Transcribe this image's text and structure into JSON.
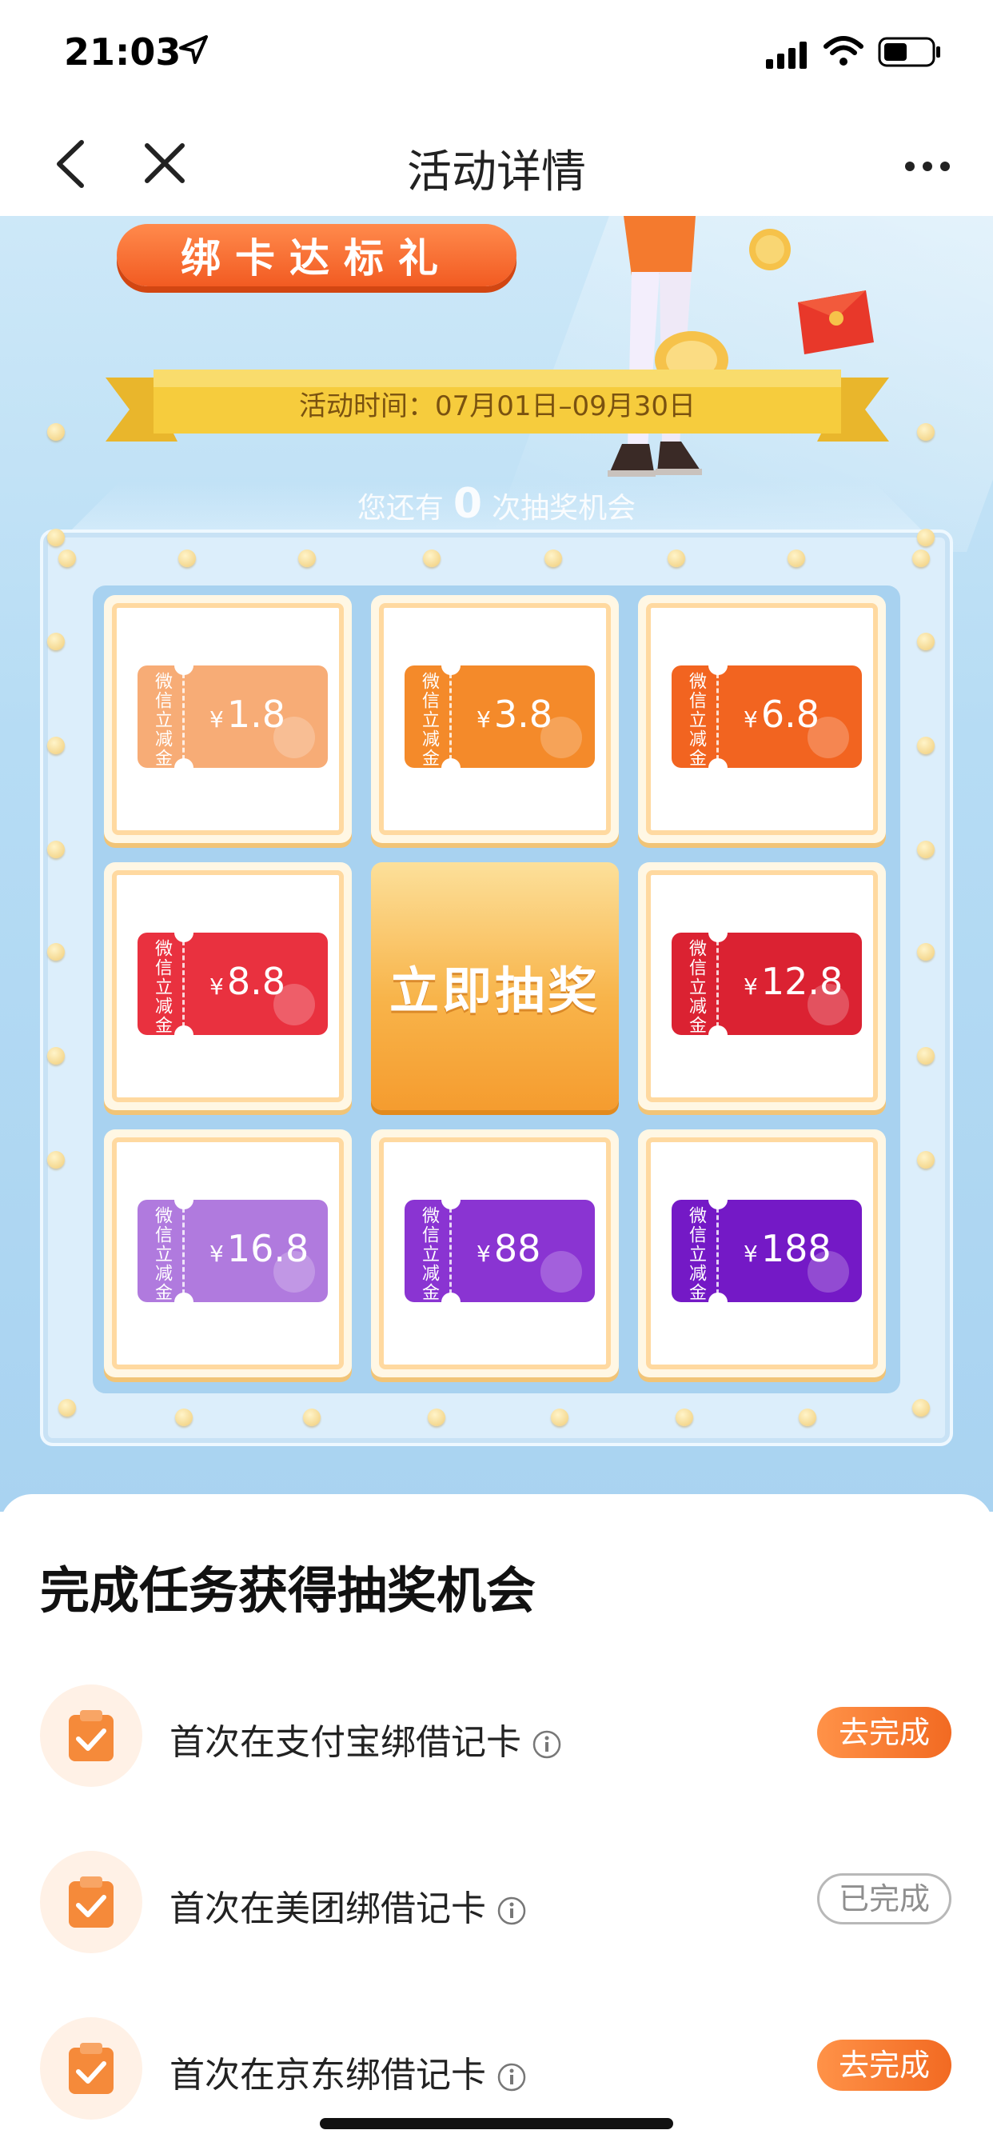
{
  "status_bar": {
    "time": "21:03"
  },
  "nav": {
    "title": "活动详情"
  },
  "hero": {
    "banner_title": "绑卡达标礼",
    "activity_time": "活动时间：07月01日–09月30日",
    "chances_prefix": "您还有",
    "chances_count": "0",
    "chances_suffix": "次抽奖机会"
  },
  "lottery": {
    "draw_button": "立即抽奖",
    "prizes": [
      {
        "label": "微信立减金",
        "currency": "¥",
        "amount": "1.8",
        "color": "#f7ac76"
      },
      {
        "label": "微信立减金",
        "currency": "¥",
        "amount": "3.8",
        "color": "#f48a2a"
      },
      {
        "label": "微信立减金",
        "currency": "¥",
        "amount": "6.8",
        "color": "#f26420"
      },
      {
        "label": "微信立减金",
        "currency": "¥",
        "amount": "8.8",
        "color": "#e9313f"
      },
      {
        "label": "微信立减金",
        "currency": "¥",
        "amount": "12.8",
        "color": "#db2232"
      },
      {
        "label": "微信立减金",
        "currency": "¥",
        "amount": "16.8",
        "color": "#b07ade"
      },
      {
        "label": "微信立减金",
        "currency": "¥",
        "amount": "88",
        "color": "#8a34d2"
      },
      {
        "label": "微信立减金",
        "currency": "¥",
        "amount": "188",
        "color": "#7419c6"
      }
    ]
  },
  "tasks": {
    "title": "完成任务获得抽奖机会",
    "items": [
      {
        "text": "首次在支付宝绑借记卡",
        "button": "去完成",
        "status": "todo"
      },
      {
        "text": "首次在美团绑借记卡",
        "button": "已完成",
        "status": "done"
      },
      {
        "text": "首次在京东绑借记卡",
        "button": "去完成",
        "status": "todo"
      }
    ]
  },
  "colors": {
    "accent": "#f26a22",
    "hero_bg": "#b6dcf4",
    "draw_button": "#f8b44a"
  },
  "icons": [
    "location-arrow-icon",
    "signal-icon",
    "wifi-icon",
    "battery-icon",
    "back-icon",
    "close-icon",
    "more-icon",
    "clipboard-check-icon",
    "info-icon"
  ]
}
